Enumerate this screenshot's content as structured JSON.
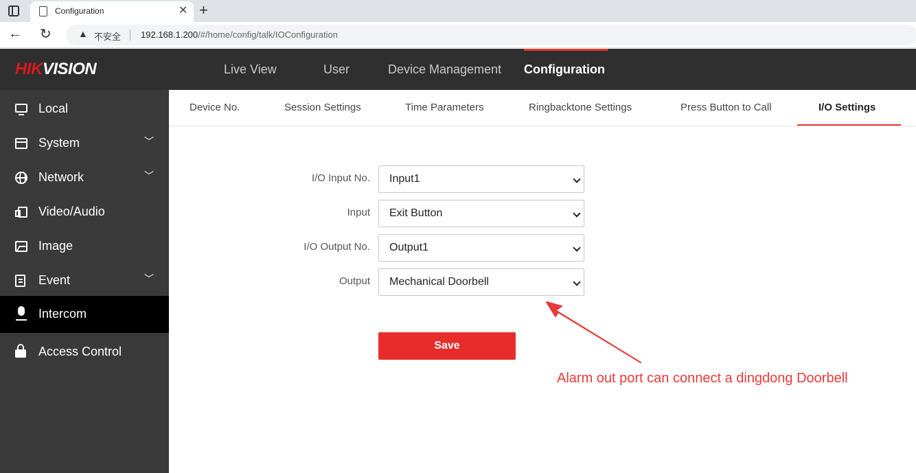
{
  "browser": {
    "tab_title": "Configuration",
    "new_tab": "+",
    "close": "✕",
    "not_secure": "不安全",
    "url_host": "192.168.1.200",
    "url_path": "/#/home/config/talk/IOConfiguration"
  },
  "header": {
    "logo_hik": "HIK",
    "logo_vision": "VISION",
    "nav": [
      {
        "label": "Live View"
      },
      {
        "label": "User"
      },
      {
        "label": "Device Management"
      },
      {
        "label": "Configuration",
        "active": true
      }
    ]
  },
  "sidebar": {
    "items": [
      {
        "label": "Local",
        "icon": "monitor-icon"
      },
      {
        "label": "System",
        "icon": "window-icon",
        "expandable": true
      },
      {
        "label": "Network",
        "icon": "globe-icon",
        "expandable": true
      },
      {
        "label": "Video/Audio",
        "icon": "video-icon"
      },
      {
        "label": "Image",
        "icon": "image-icon"
      },
      {
        "label": "Event",
        "icon": "clipboard-icon",
        "expandable": true
      },
      {
        "label": "Intercom",
        "icon": "microphone-icon",
        "active": true
      },
      {
        "label": "Access Control",
        "icon": "lock-icon"
      }
    ]
  },
  "subtabs": [
    {
      "label": "Device No."
    },
    {
      "label": "Session Settings"
    },
    {
      "label": "Time Parameters"
    },
    {
      "label": "Ringbacktone Settings"
    },
    {
      "label": "Press Button to Call"
    },
    {
      "label": "I/O Settings",
      "active": true
    }
  ],
  "form": {
    "io_input_no": {
      "label": "I/O Input No.",
      "value": "Input1"
    },
    "input": {
      "label": "Input",
      "value": "Exit Button"
    },
    "io_output_no": {
      "label": "I/O Output No.",
      "value": "Output1"
    },
    "output": {
      "label": "Output",
      "value": "Mechanical Doorbell"
    },
    "save_label": "Save"
  },
  "annotation": {
    "text": "Alarm out port can connect a dingdong Doorbell",
    "color": "#e83a3a"
  },
  "colors": {
    "accent": "#e8382d",
    "save_button": "#e82c2c",
    "header_bg": "#2f2f2f",
    "sidebar_bg": "#3a3a3a"
  }
}
